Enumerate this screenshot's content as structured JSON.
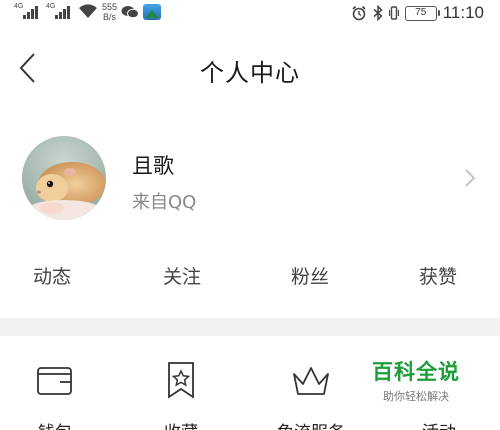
{
  "status_bar": {
    "sim1_label": "4G",
    "sim2_label": "4G",
    "net_speed_value": "555",
    "net_speed_unit": "B/s",
    "battery": "75",
    "time": "11:10"
  },
  "header": {
    "title": "个人中心"
  },
  "profile": {
    "name": "且歌",
    "source": "来自QQ"
  },
  "stats": [
    {
      "label": "动态"
    },
    {
      "label": "关注"
    },
    {
      "label": "粉丝"
    },
    {
      "label": "获赞"
    }
  ],
  "menu": [
    {
      "label": "钱包",
      "icon": "wallet-icon"
    },
    {
      "label": "收藏",
      "icon": "bookmark-star-icon"
    },
    {
      "label": "免流服务",
      "icon": "crown-icon"
    },
    {
      "label": "活动",
      "icon": "activity-icon"
    }
  ],
  "watermark": {
    "title": "百科全说",
    "subtitle": "助你轻松解决"
  },
  "colors": {
    "background": "#ffffff",
    "section_divider": "#f2f2f2",
    "watermark_green": "#1c9e3a"
  }
}
